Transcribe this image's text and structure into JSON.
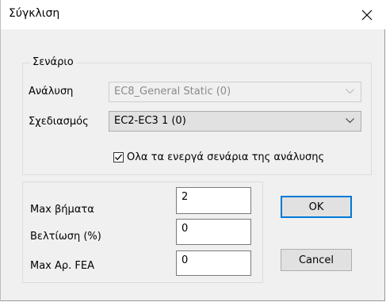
{
  "dialog": {
    "title": "Σύγκλιση",
    "close_glyph": "✕"
  },
  "scenario_group": {
    "title": "Σενάριο",
    "analysis_label": "Ανάλυση",
    "analysis_value": "EC8_General Static (0)",
    "analysis_enabled": false,
    "design_label": "Σχεδιασμός",
    "design_value": "EC2-EC3 1 (0)",
    "all_scenarios_label": "Ολα τα ενεργά σενάρια της ανάλυσης",
    "all_scenarios_checked": true
  },
  "params_group": {
    "max_steps_label": "Max βήματα",
    "max_steps_value": "2",
    "improvement_label": "Βελτίωση (%)",
    "improvement_value": "0",
    "max_fea_label": "Max Αρ. FEA",
    "max_fea_value": "0"
  },
  "buttons": {
    "ok_label": "OK",
    "cancel_label": "Cancel"
  },
  "colors": {
    "accent": "#0078d7",
    "window_bg": "#f0f0f0",
    "disabled_text": "#8a8a8a"
  }
}
